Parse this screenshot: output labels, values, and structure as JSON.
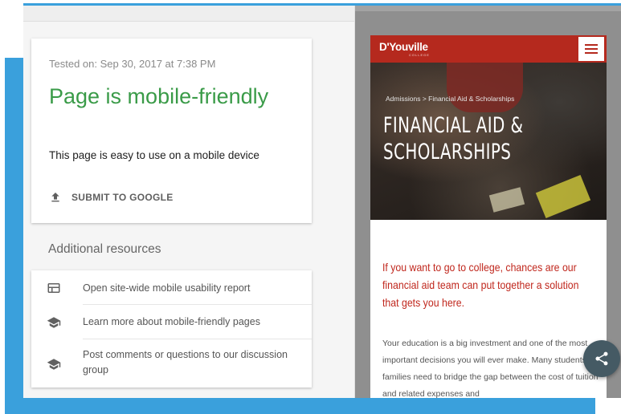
{
  "result": {
    "tested_on": "Tested on: Sep 30, 2017 at 7:38 PM",
    "title": "Page is mobile-friendly",
    "description": "This page is easy to use on a mobile device",
    "submit_label": "SUBMIT TO GOOGLE"
  },
  "resources": {
    "heading": "Additional resources",
    "items": [
      {
        "label": "Open site-wide mobile usability report",
        "icon": "report-icon"
      },
      {
        "label": "Learn more about mobile-friendly pages",
        "icon": "school-icon"
      },
      {
        "label": "Post comments or questions to our discussion group",
        "icon": "school-icon"
      }
    ]
  },
  "preview": {
    "logo": "D'Youville",
    "logo_sub": "COLLEGE",
    "breadcrumb": "Admissions > Financial Aid & Scholarships",
    "hero_title": "FINANCIAL AID & SCHOLARSHIPS",
    "lead": "If you want to go to college, chances are our financial aid team can put together a solution that gets you here.",
    "body": "Your education is a big investment and one of the most important decisions you will ever make. Many students and families need to bridge the gap between the cost of tuition and related expenses and"
  },
  "colors": {
    "success": "#3a9b48",
    "brand_red": "#b5291e",
    "frame_blue": "#3aa0dc",
    "fab": "#455a64"
  }
}
